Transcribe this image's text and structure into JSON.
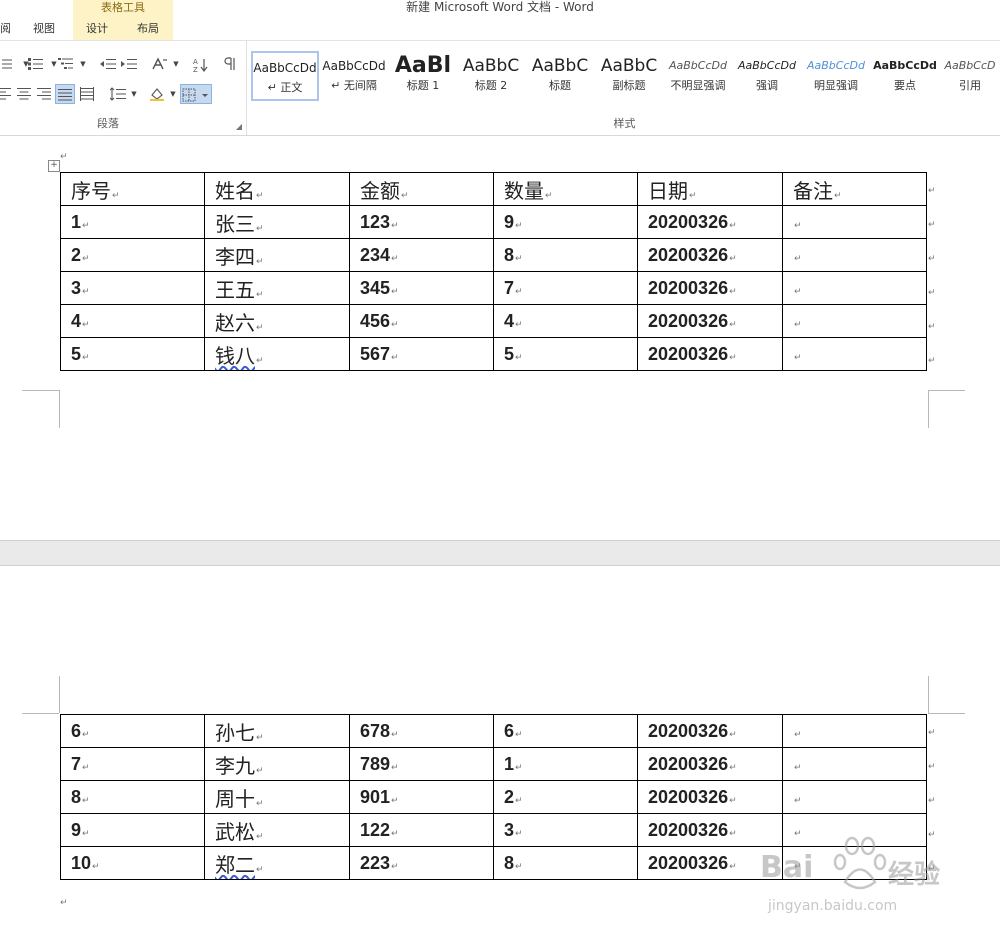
{
  "window": {
    "title": "新建 Microsoft Word 文档 - Word"
  },
  "context_group": {
    "label": "表格工具"
  },
  "tabs": [
    {
      "label": "阅"
    },
    {
      "label": "视图"
    },
    {
      "label": "设计"
    },
    {
      "label": "布局"
    }
  ],
  "ribbon": {
    "paragraph_group_label": "段落",
    "styles_group_label": "样式",
    "styles": [
      {
        "sample": "AaBbCcDd",
        "name": "↵ 正文"
      },
      {
        "sample": "AaBbCcDd",
        "name": "↵ 无间隔"
      },
      {
        "sample": "AaBl",
        "name": "标题 1"
      },
      {
        "sample": "AaBbC",
        "name": "标题 2"
      },
      {
        "sample": "AaBbC",
        "name": "标题"
      },
      {
        "sample": "AaBbC",
        "name": "副标题"
      },
      {
        "sample": "AaBbCcDd",
        "name": "不明显强调"
      },
      {
        "sample": "AaBbCcDd",
        "name": "强调"
      },
      {
        "sample": "AaBbCcDd",
        "name": "明显强调"
      },
      {
        "sample": "AaBbCcDd",
        "name": "要点"
      },
      {
        "sample": "AaBbCcD",
        "name": "引用"
      }
    ]
  },
  "document": {
    "paragraph_mark": "↵",
    "headers": [
      "序号",
      "姓名",
      "金额",
      "数量",
      "日期",
      "备注"
    ],
    "page1_rows": [
      [
        "1",
        "张三",
        "123",
        "9",
        "20200326",
        ""
      ],
      [
        "2",
        "李四",
        "234",
        "8",
        "20200326",
        ""
      ],
      [
        "3",
        "王五",
        "345",
        "7",
        "20200326",
        ""
      ],
      [
        "4",
        "赵六",
        "456",
        "4",
        "20200326",
        ""
      ],
      [
        "5",
        "钱八",
        "567",
        "5",
        "20200326",
        ""
      ]
    ],
    "page2_rows": [
      [
        "6",
        "孙七",
        "678",
        "6",
        "20200326",
        ""
      ],
      [
        "7",
        "李九",
        "789",
        "1",
        "20200326",
        ""
      ],
      [
        "8",
        "周十",
        "901",
        "2",
        "20200326",
        ""
      ],
      [
        "9",
        "武松",
        "122",
        "3",
        "20200326",
        ""
      ],
      [
        "10",
        "郑二",
        "223",
        "8",
        "20200326",
        ""
      ]
    ]
  },
  "watermark": {
    "brand": "Bai",
    "brand_cn": "经验",
    "url": "jingyan.baidu.com"
  }
}
